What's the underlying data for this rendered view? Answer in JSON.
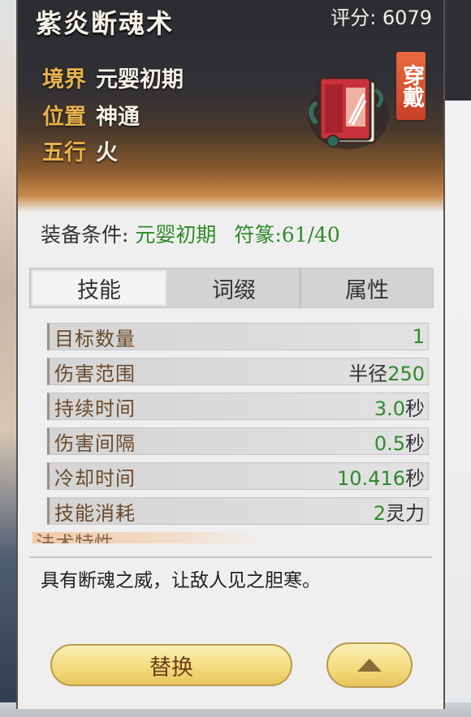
{
  "item": {
    "title": "紫炎断魂术",
    "score": "评分: 6079",
    "realm_label": "境界",
    "realm_value": "元婴初期",
    "position_label": "位置",
    "position_value": "神通",
    "element_label": "五行",
    "element_value": "火",
    "wear_tag": "穿戴",
    "book_icon": "red-tome-icon"
  },
  "requirement": {
    "label": "装备条件:",
    "realm": "元婴初期",
    "talisman": "符篆:61/40"
  },
  "tabs": [
    {
      "label": "技能"
    },
    {
      "label": "词缀"
    },
    {
      "label": "属性"
    }
  ],
  "active_tab": "技能",
  "stats": [
    {
      "label": "目标数量",
      "prefix": "",
      "value": "1",
      "unit": ""
    },
    {
      "label": "伤害范围",
      "prefix": "半径",
      "value": "250",
      "unit": ""
    },
    {
      "label": "持续时间",
      "prefix": "",
      "value": "3.0",
      "unit": "秒"
    },
    {
      "label": "伤害间隔",
      "prefix": "",
      "value": "0.5",
      "unit": "秒"
    },
    {
      "label": "冷却时间",
      "prefix": "",
      "value": "10.416",
      "unit": "秒"
    },
    {
      "label": "技能消耗",
      "prefix": "",
      "value": "2",
      "unit": "灵力"
    }
  ],
  "section_partial": "法术特性",
  "description": "具有断魂之威，让敌人见之胆寒。",
  "buttons": {
    "replace": "替换",
    "collapse_icon": "triangle-up-icon"
  },
  "colors": {
    "green_value": "#2f8a2a",
    "gold_label": "#e9b24c",
    "button_gold": "#f3d97a",
    "wear_tag": "#d9553a"
  }
}
